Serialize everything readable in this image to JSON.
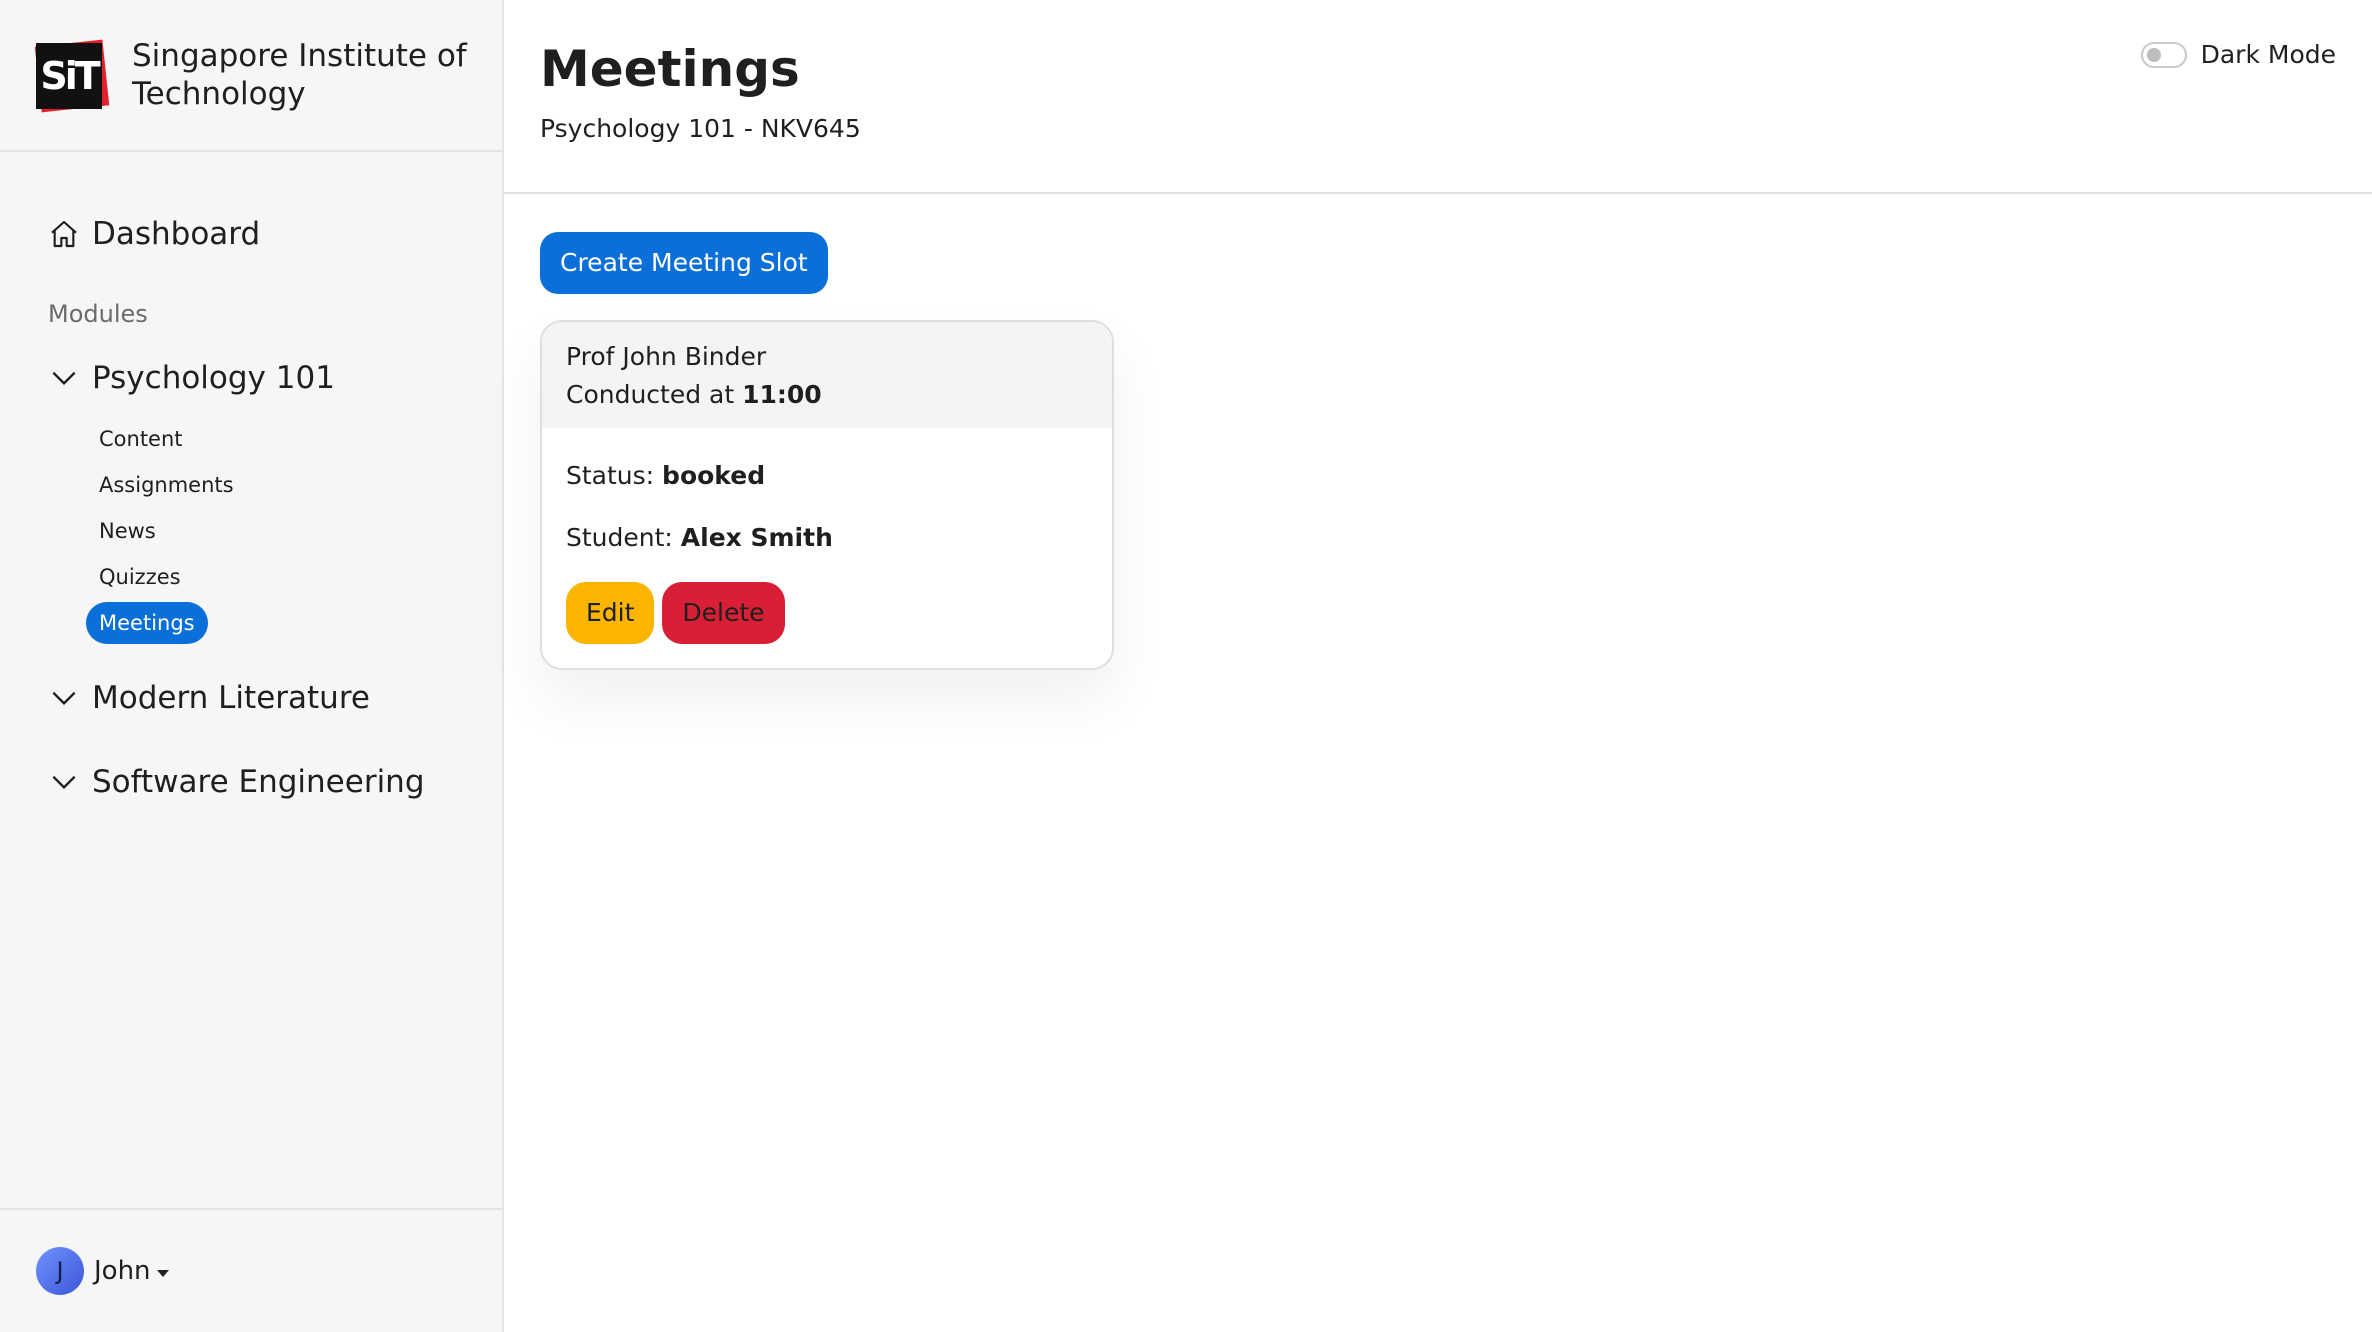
{
  "brand": {
    "logo_text": "SiT",
    "name": "Singapore Institute of Technology"
  },
  "nav": {
    "dashboard_label": "Dashboard",
    "modules_label": "Modules",
    "modules": [
      {
        "label": "Psychology 101",
        "expanded": true,
        "items": [
          "Content",
          "Assignments",
          "News",
          "Quizzes",
          "Meetings"
        ],
        "active_item": "Meetings"
      },
      {
        "label": "Modern Literature",
        "expanded": false
      },
      {
        "label": "Software Engineering",
        "expanded": false
      }
    ]
  },
  "user": {
    "initial": "J",
    "name": "John"
  },
  "header": {
    "title": "Meetings",
    "subtitle": "Psychology 101 - NKV645",
    "dark_mode_label": "Dark Mode",
    "dark_mode_on": false
  },
  "main": {
    "create_button": "Create Meeting Slot",
    "meeting": {
      "professor": "Prof John Binder",
      "conducted_prefix": "Conducted at ",
      "time": "11:00",
      "status_label": "Status: ",
      "status": "booked",
      "student_label": "Student: ",
      "student": "Alex Smith",
      "edit_label": "Edit",
      "delete_label": "Delete"
    }
  },
  "colors": {
    "accent": "#0a6fd8",
    "edit": "#fbb400",
    "delete": "#d81f35",
    "sidebar_bg": "#f6f6f7"
  }
}
